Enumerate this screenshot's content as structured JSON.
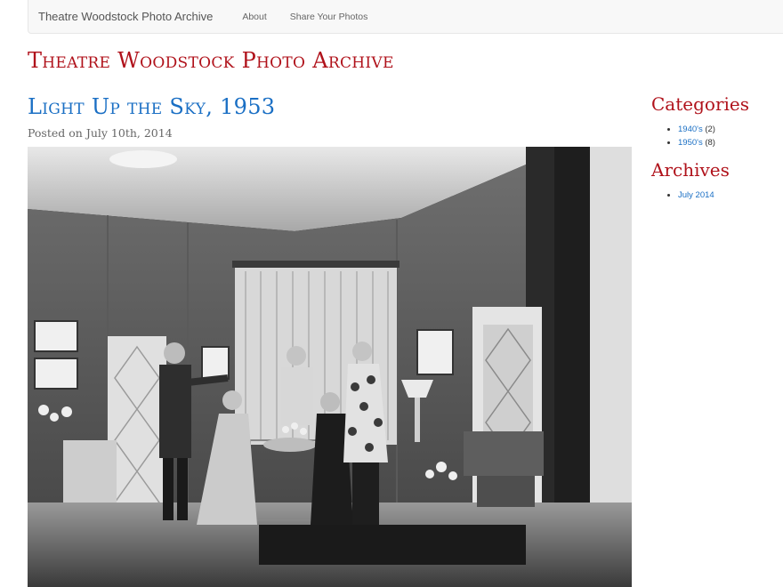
{
  "nav": {
    "brand": "Theatre Woodstock Photo Archive",
    "links": [
      {
        "label": "About"
      },
      {
        "label": "Share Your Photos"
      }
    ]
  },
  "site": {
    "title": "Theatre Woodstock Photo Archive"
  },
  "post": {
    "title": "Light Up the Sky, 1953",
    "meta_prefix": "Posted on",
    "date": "July 10th, 2014"
  },
  "sidebar": {
    "categories": {
      "title": "Categories",
      "items": [
        {
          "label": "1940's",
          "count": "(2)"
        },
        {
          "label": "1950's",
          "count": "(8)"
        }
      ]
    },
    "archives": {
      "title": "Archives",
      "items": [
        {
          "label": "July 2014"
        }
      ]
    }
  },
  "colors": {
    "accent_red": "#b0121b",
    "link_blue": "#1a6fc4"
  }
}
